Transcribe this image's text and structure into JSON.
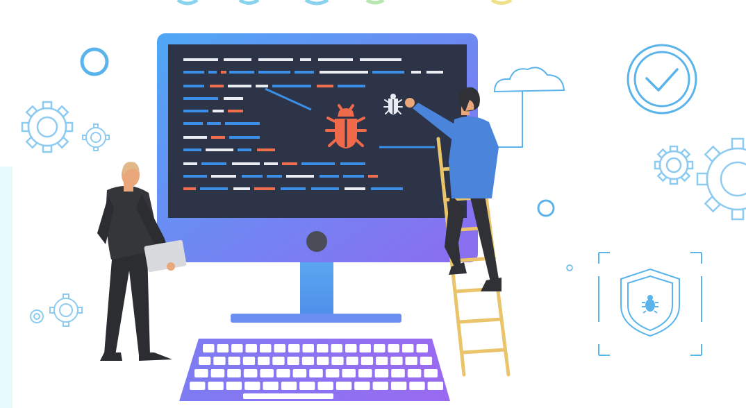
{
  "scene": {
    "subject": "debugging-illustration",
    "palette": {
      "background": "#ffffff",
      "screen": "#2e3447",
      "monitor_gradient_start": "#4fa7f5",
      "monitor_gradient_end": "#8c6cf0",
      "stand": "#5aa6f2",
      "code_white": "#e9edf3",
      "code_blue": "#3b8fe6",
      "code_orange": "#f06d4f",
      "bug": "#ee6a4a",
      "outline_icon": "#5ab3ea",
      "ladder": "#e9c46a",
      "man_shirt": "#4a84db",
      "man_pants": "#2f3136",
      "suit": "#34363a",
      "skin": "#e9a77b",
      "keyboard": "#8c6cf0"
    },
    "icons": [
      "bug-icon",
      "small-bug-icon",
      "cloud-icon",
      "checkmark-circle-icon",
      "gear-icon",
      "shield-bug-icon",
      "ring-icon"
    ]
  }
}
